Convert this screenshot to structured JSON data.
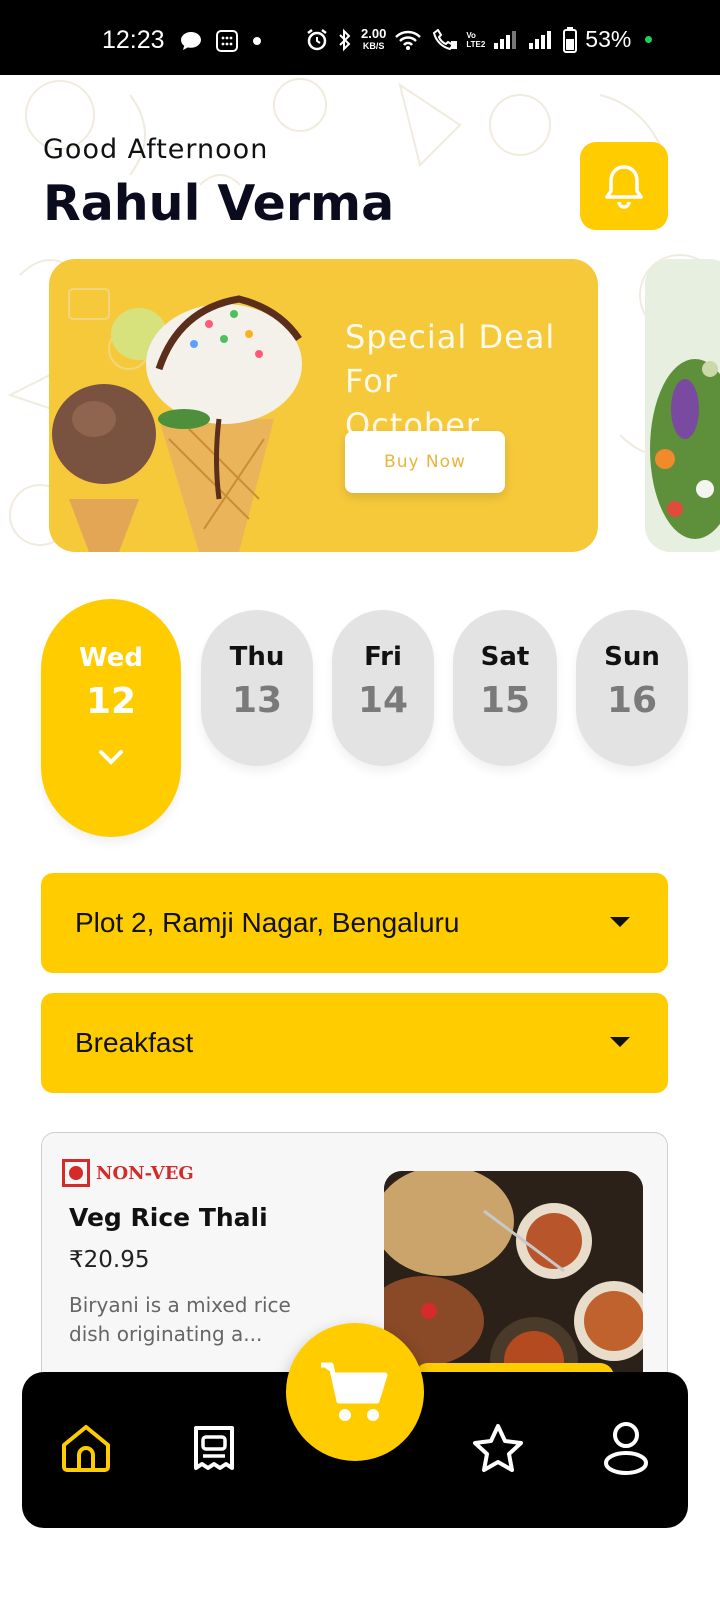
{
  "status_bar": {
    "time": "12:23",
    "net_speed_value": "2.00",
    "net_speed_unit": "KB/S",
    "volte_top": "Vo",
    "volte_bottom": "LTE2",
    "battery": "53%"
  },
  "header": {
    "greeting": "Good Afternoon",
    "user_name": "Rahul Verma"
  },
  "banner": {
    "title": "Special Deal For\nOctober",
    "button_label": "Buy Now"
  },
  "days": [
    {
      "name": "Wed",
      "num": "12",
      "active": true
    },
    {
      "name": "Thu",
      "num": "13",
      "active": false
    },
    {
      "name": "Fri",
      "num": "14",
      "active": false
    },
    {
      "name": "Sat",
      "num": "15",
      "active": false
    },
    {
      "name": "Sun",
      "num": "16",
      "active": false
    }
  ],
  "filters": {
    "location": "Plot 2, Ramji Nagar, Bengaluru",
    "meal": "Breakfast"
  },
  "food_card": {
    "tag": "NON-VEG",
    "name": "Veg Rice Thali",
    "price": "₹20.95",
    "description": "Biryani is a mixed rice dish originating a..."
  },
  "nav": {
    "items": [
      "home-icon",
      "orders-icon",
      "favorites-icon",
      "profile-icon"
    ],
    "center": "cart-icon"
  },
  "colors": {
    "accent": "#ffcc00",
    "banner_bg": "#f6c93b",
    "non_veg": "#d42a2a",
    "nav_bg": "#000000"
  }
}
